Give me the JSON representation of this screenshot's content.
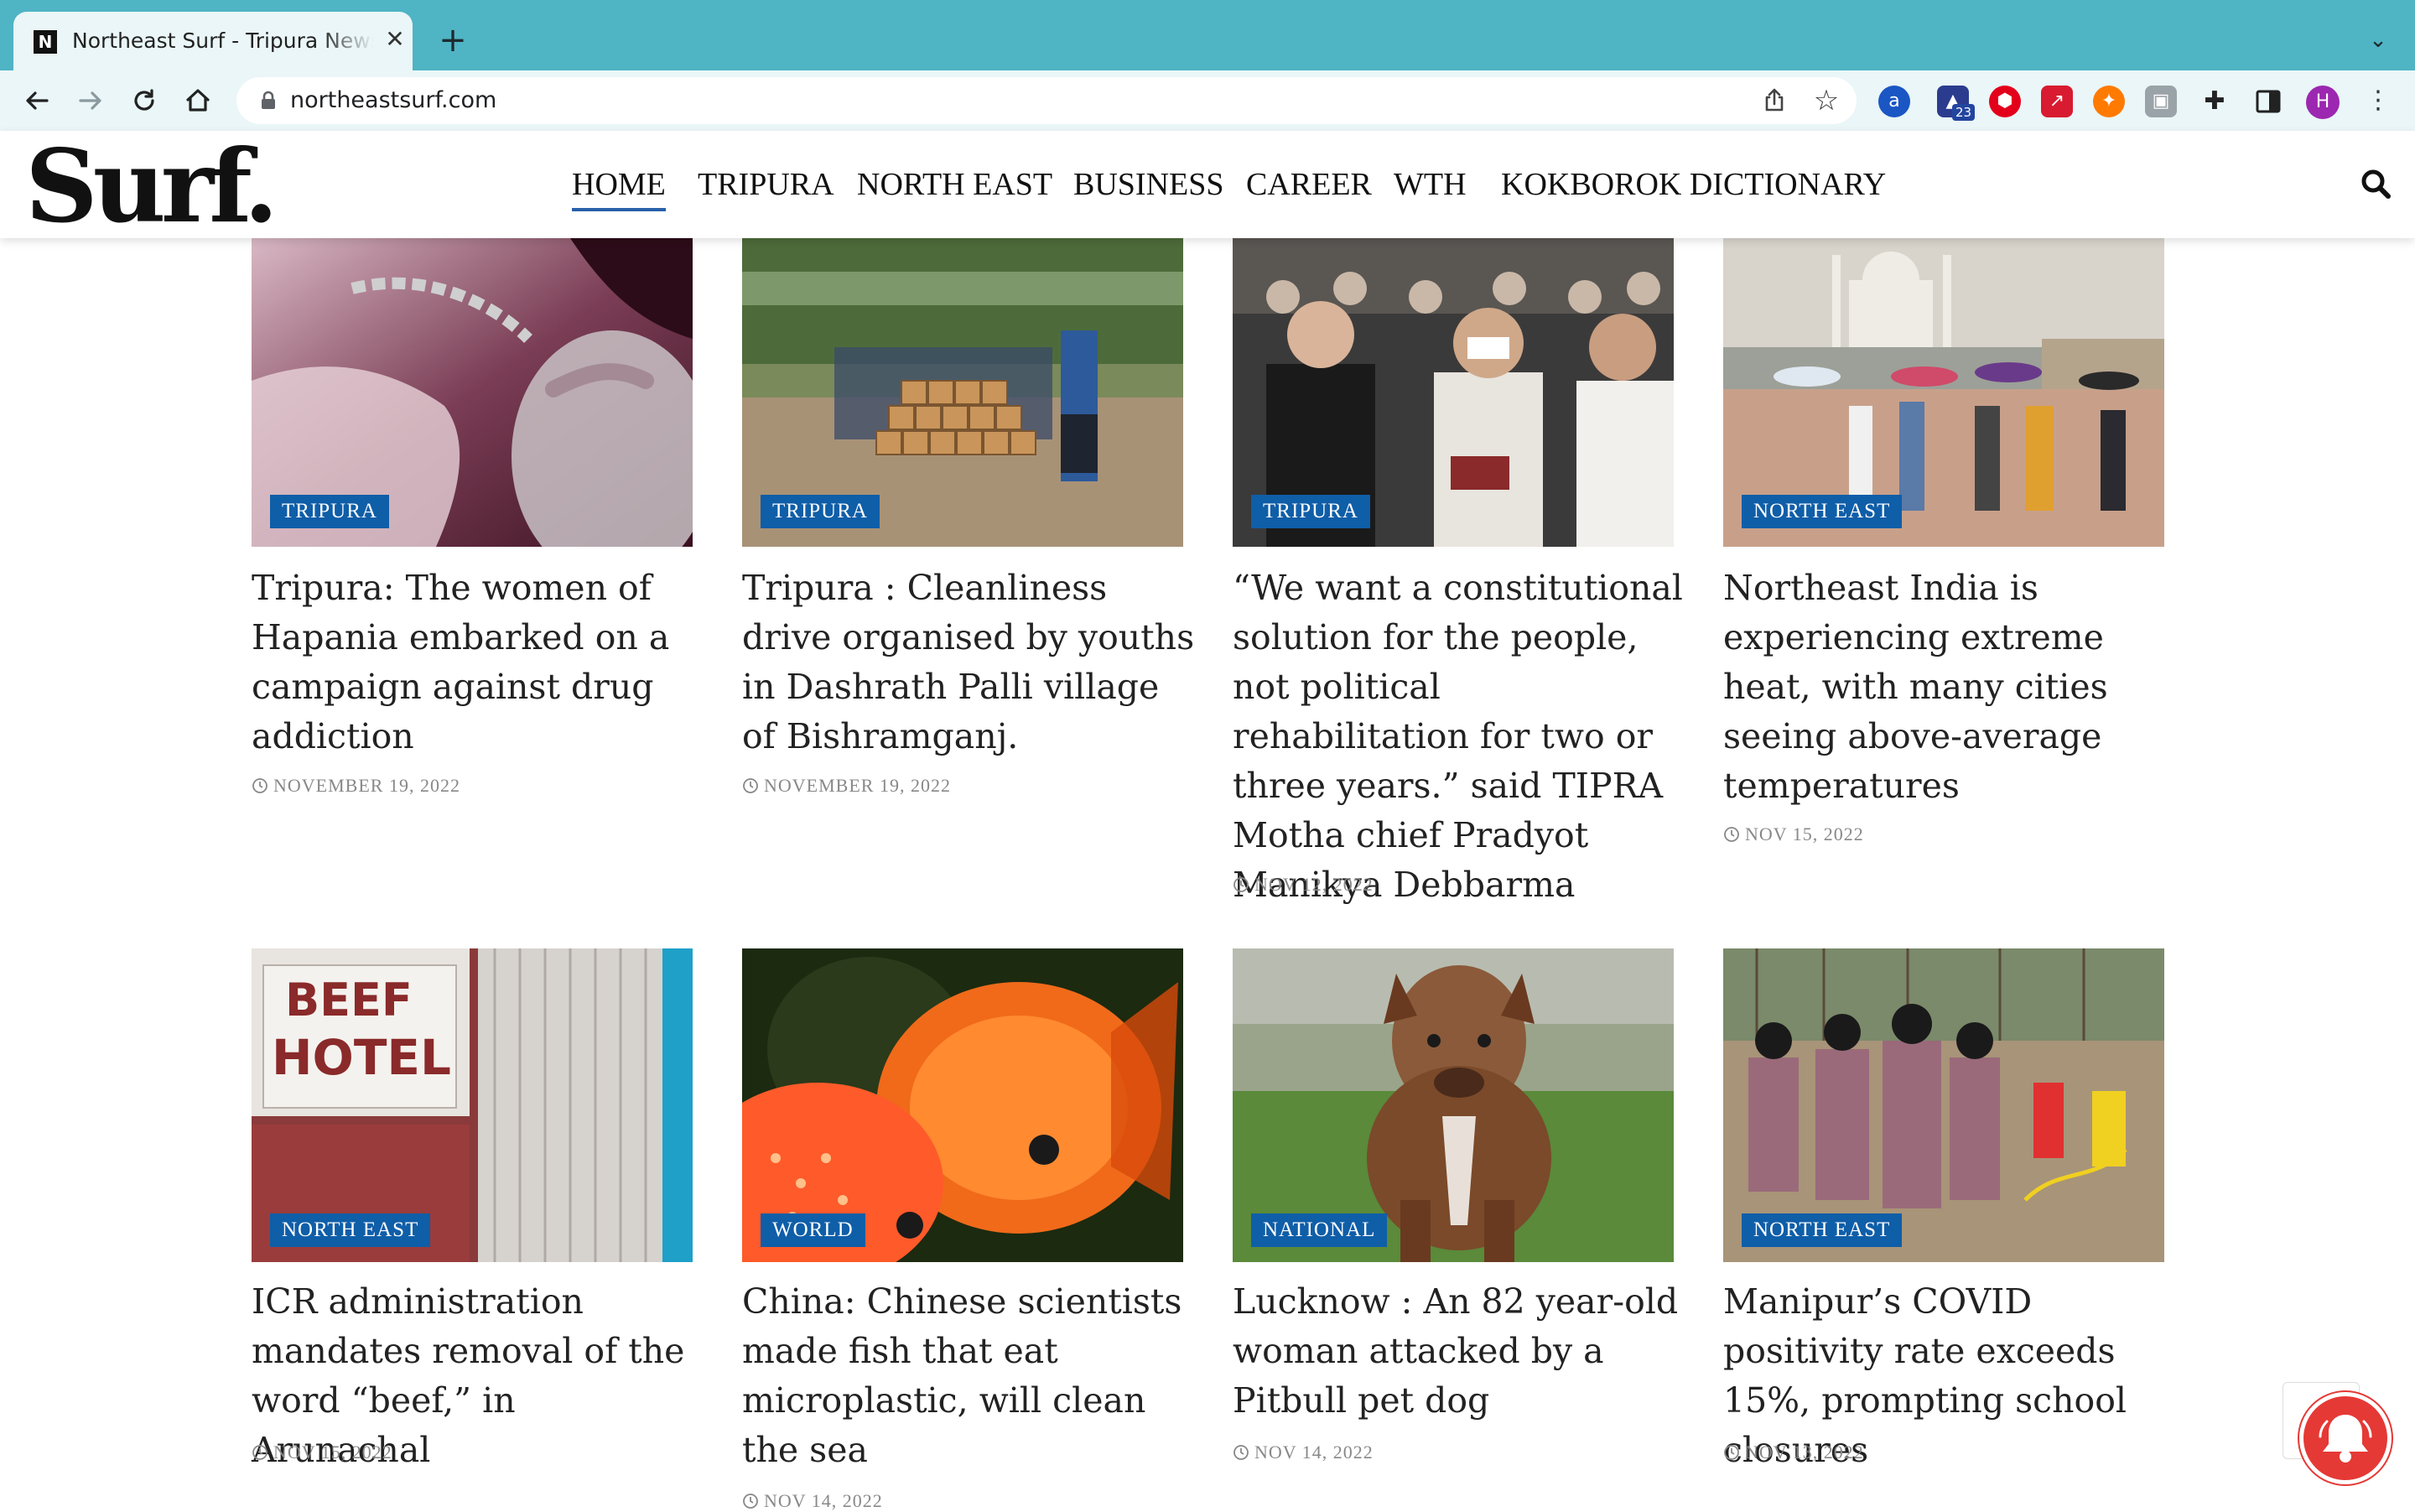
{
  "browser": {
    "tab_title": "Northeast Surf - Tripura News, Northeast News",
    "tab_favicon": "N",
    "tab_close": "✕",
    "new_tab": "+",
    "url": "northeastsurf.com",
    "extension_badge": "23",
    "profile_initial": "H"
  },
  "site": {
    "logo": "Surf.",
    "nav": [
      "HOME",
      "TRIPURA",
      "NORTH EAST",
      "BUSINESS",
      "CAREER",
      "WTH",
      "KOKBOROK DICTIONARY"
    ],
    "active_nav": "HOME"
  },
  "articles": [
    {
      "category": "TRIPURA",
      "title": "Tripura: The women of Hapania embarked on a campaign against drug addiction",
      "date": "NOVEMBER 19, 2022"
    },
    {
      "category": "TRIPURA",
      "title": "Tripura : Cleanliness drive organised by youths in Dashrath Palli village of Bishramganj.",
      "date": "NOVEMBER 19, 2022"
    },
    {
      "category": "TRIPURA",
      "title": "“We want a constitutional solution for the people, not political rehabilitation for two or three years.” said TIPRA Motha chief Pradyot Manikya Debbarma",
      "date": "NOV 12, 2022"
    },
    {
      "category": "NORTH EAST",
      "title": "Northeast India is experiencing extreme heat, with many cities seeing above-average temperatures",
      "date": "NOV 15, 2022"
    },
    {
      "category": "NORTH EAST",
      "title": "ICR administration mandates removal of the word “beef,” in Arunachal",
      "date": "NOV 15, 2022",
      "image_text": [
        "BEEF",
        "HOTEL"
      ]
    },
    {
      "category": "WORLD",
      "title": "China: Chinese scientists made fish that eat microplastic, will clean the sea",
      "date": "NOV 14, 2022"
    },
    {
      "category": "NATIONAL",
      "title": "Lucknow : An 82 year-old woman attacked by a Pitbull pet dog",
      "date": "NOV 14, 2022"
    },
    {
      "category": "NORTH EAST",
      "title": "Manipur’s COVID positivity rate exceeds 15%, prompting school closures",
      "date": "NOV 13, 2022"
    }
  ],
  "colors": {
    "tab_strip": "#4fb4c4",
    "toolbar": "#eaf6f7",
    "category_badge": "#0f5ea8",
    "nav_active_underline": "#2960a8",
    "notification_button": "#e53935"
  },
  "icons": [
    "back-icon",
    "forward-icon",
    "reload-icon",
    "home-icon",
    "lock-icon",
    "share-icon",
    "star-icon",
    "extensions-icon",
    "side-panel-icon",
    "search-icon",
    "clock-icon",
    "bell-icon"
  ]
}
